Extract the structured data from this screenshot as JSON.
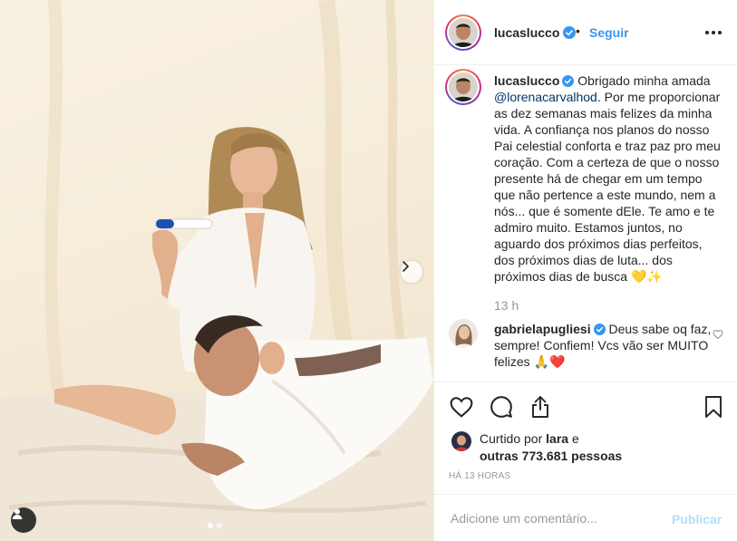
{
  "post": {
    "username": "lucaslucco",
    "follow_label": "Seguir",
    "separator": "•"
  },
  "caption": {
    "username": "lucaslucco",
    "mention": "@lorenacarvalhod",
    "text_before": "Obrigado minha amada",
    "text_after": ". Por me proporcionar as dez semanas mais felizes da minha vida. A confiança nos planos do nosso Pai celestial conforta e traz paz pro meu coração. Com a certeza de que o nosso presente há de chegar em um tempo que não pertence a este mundo, nem a nós... que é somente dEle. Te amo e te admiro muito. Estamos juntos, no aguardo dos próximos dias perfeitos, dos próximos dias de luta... dos próximos dias de busca 💛✨",
    "time": "13 h"
  },
  "comment": {
    "username": "gabrielapugliesi",
    "text": "Deus sabe oq faz, sempre! Confiem! Vcs vão ser MUITO felizes 🙏❤️"
  },
  "likes": {
    "prefix": "Curtido por",
    "first_user": "lara",
    "conjunction": "e",
    "others": "outras 773.681 pessoas"
  },
  "timestamp": "HÁ 13 HORAS",
  "add_comment": {
    "placeholder": "Adicione um comentário...",
    "publish_label": "Publicar"
  },
  "carousel": {
    "total": 2,
    "current": 1
  },
  "icons": {
    "verified": "verified-badge-icon",
    "more": "more-options-icon",
    "like": "heart-icon",
    "comment": "comment-bubble-icon",
    "share": "share-icon",
    "save": "bookmark-icon",
    "next": "chevron-right-icon",
    "tag": "user-tag-icon"
  },
  "colors": {
    "link_blue": "#3897f0",
    "mention": "#003569",
    "verified": "#3897f0",
    "heart_red": "#ed4956",
    "publish_disabled": "#b2dffc"
  }
}
